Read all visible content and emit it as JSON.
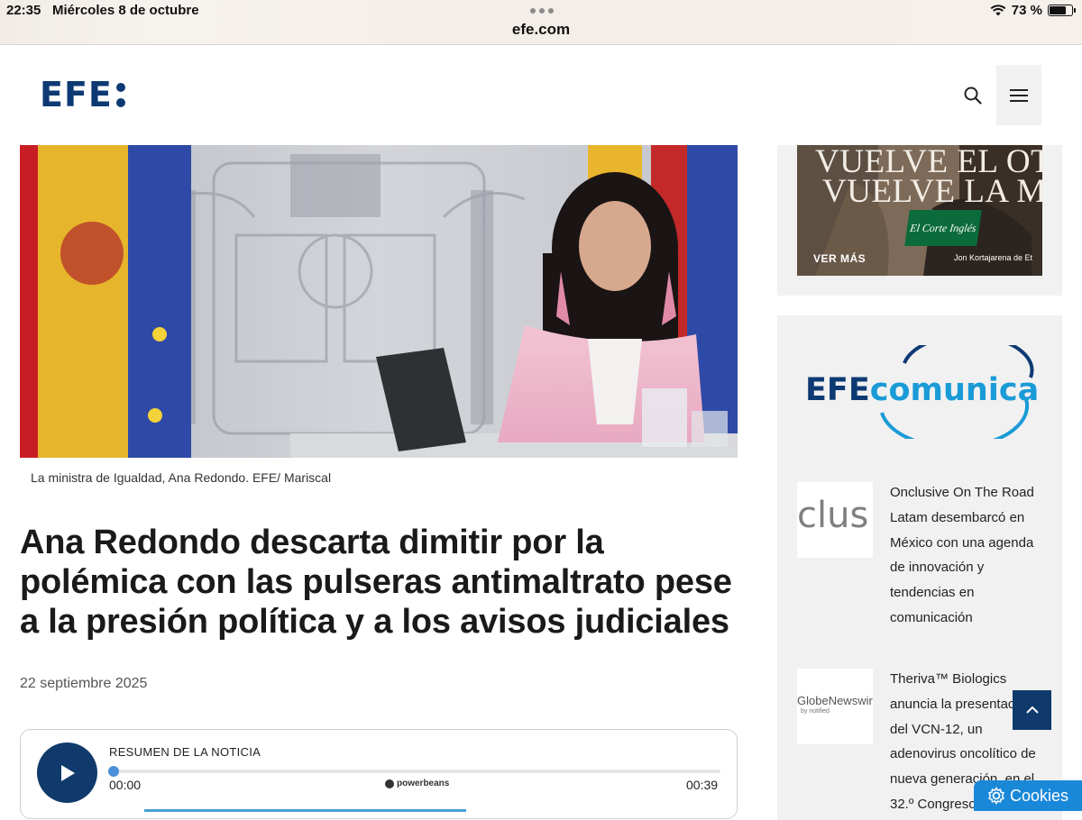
{
  "status_bar": {
    "time": "22:35",
    "date": "Miércoles 8 de octubre",
    "battery": "73 %",
    "battery_level": 0.73,
    "url": "efe.com"
  },
  "header": {
    "logo_text": "EFE",
    "icons": {
      "search": "search-icon",
      "menu": "hamburger-menu-icon"
    }
  },
  "article": {
    "image_caption": "La ministra de Igualdad, Ana Redondo. EFE/ Mariscal",
    "headline": "Ana Redondo descarta dimitir por la polémica con las pulseras antimaltrato pese a la presión política y a los avisos judiciales",
    "date": "22 septiembre 2025"
  },
  "audio_player": {
    "title": "RESUMEN DE LA NOTICIA",
    "time_current": "00:00",
    "time_total": "00:39",
    "provider": "powerbeans",
    "progress": 0
  },
  "sidebar": {
    "ad": {
      "line1": "VUELVE EL OTOÑ",
      "line2": "VUELVE LA MOD",
      "cta": "VER MÁS",
      "brand": "El Corte Inglés",
      "credit": "Jon Kortajarena de Et"
    },
    "comunica": {
      "efe": "EFE",
      "comunica": "comunica"
    },
    "news": [
      {
        "thumb_text": "clus",
        "text": "Onclusive On The Road Latam desembarcó en México con una agenda de innovación y tendencias en comunicación"
      },
      {
        "thumb_text": "GlobeNewswir",
        "thumb_sub": "by notified",
        "text": "Theriva™ Biologics anuncia la presentación del VCN-12, un adenovirus oncolítico de nueva generación, en el 32.º Congreso"
      }
    ]
  },
  "cookies_label": "Cookies",
  "colors": {
    "efe_blue": "#0e3a73",
    "accent_blue": "#1a88d9",
    "comunica_cyan": "#1a9bd7"
  }
}
